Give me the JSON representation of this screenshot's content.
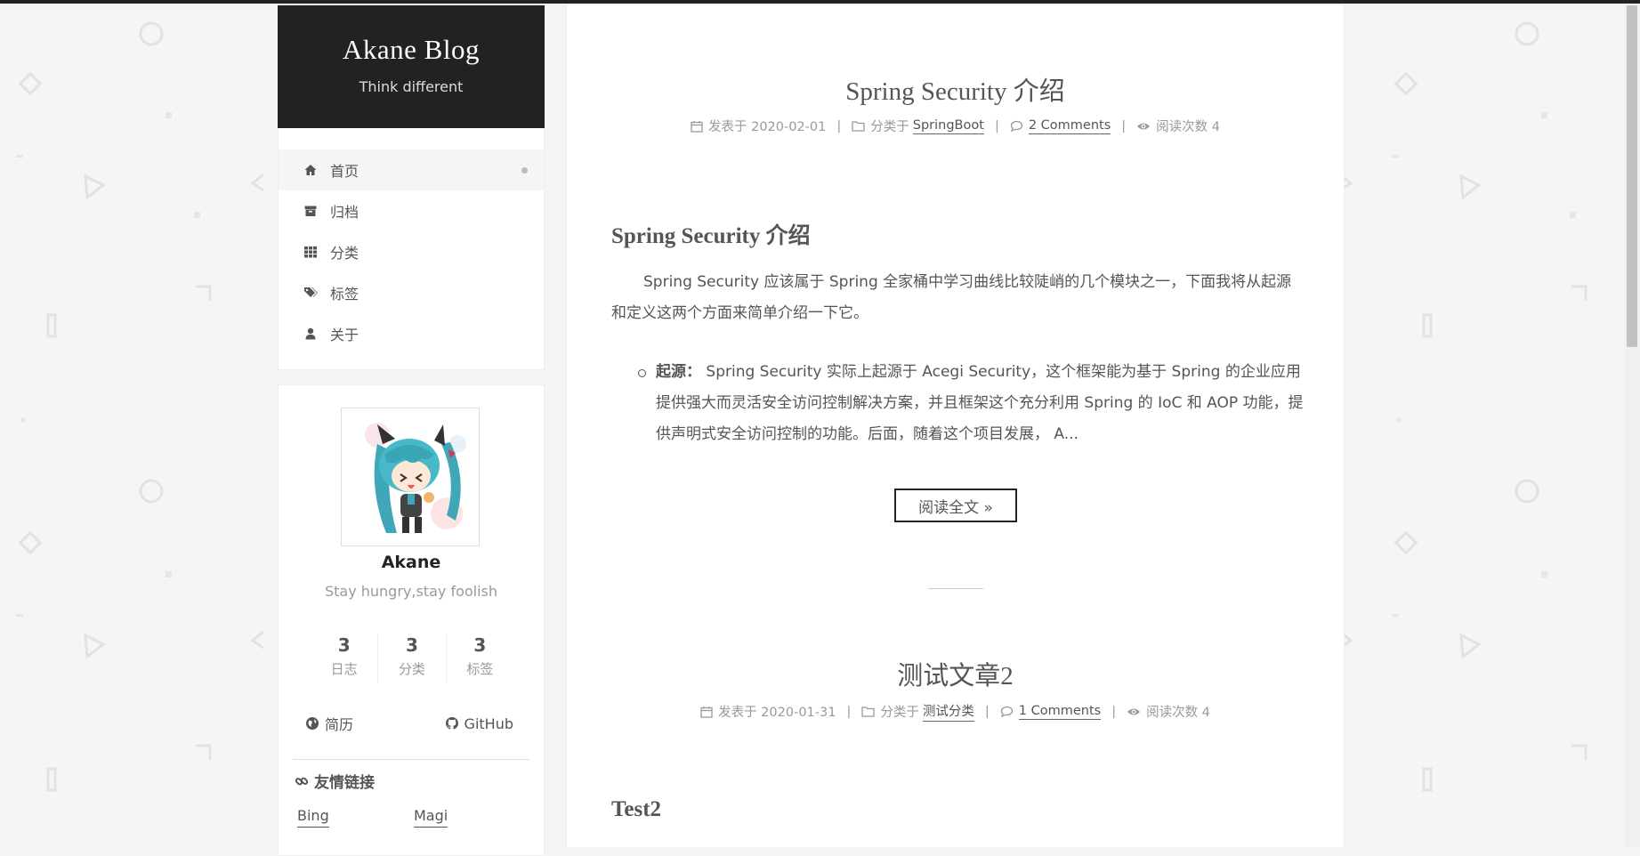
{
  "site": {
    "title": "Akane Blog",
    "subtitle": "Think different"
  },
  "menu": [
    {
      "label": "首页",
      "icon": "home-icon",
      "active": true
    },
    {
      "label": "归档",
      "icon": "archive-icon",
      "active": false
    },
    {
      "label": "分类",
      "icon": "th-icon",
      "active": false
    },
    {
      "label": "标签",
      "icon": "tags-icon",
      "active": false
    },
    {
      "label": "关于",
      "icon": "user-icon",
      "active": false
    }
  ],
  "profile": {
    "name": "Akane",
    "motto": "Stay hungry,stay foolish",
    "stats": [
      {
        "count": "3",
        "label": "日志"
      },
      {
        "count": "3",
        "label": "分类"
      },
      {
        "count": "3",
        "label": "标签"
      }
    ],
    "links": [
      {
        "label": "简历",
        "icon": "globe-icon"
      },
      {
        "label": "GitHub",
        "icon": "github-icon"
      }
    ],
    "friends_title": "友情链接",
    "friends": [
      "Bing",
      "Magi"
    ]
  },
  "posts": [
    {
      "title": "Spring Security 介绍",
      "meta": {
        "date_prefix": "发表于 2020-02-01",
        "category_prefix": "分类于",
        "category": "SpringBoot",
        "comments": "2 Comments",
        "views": "阅读次数 4"
      },
      "excerpt_heading": "Spring Security 介绍",
      "excerpt_para": "Spring Security 应该属于 Spring 全家桶中学习曲线比较陡峭的几个模块之一，下面我将从起源和定义这两个方面来简单介绍一下它。",
      "excerpt_li_label": "起源：",
      "excerpt_li_text": " Spring Security 实际上起源于 Acegi Security，这个框架能为基于 Spring 的企业应用提供强大而灵活安全访问控制解决方案，并且框架这个充分利用 Spring 的 IoC 和 AOP 功能，提供声明式安全访问控制的功能。后面，随着这个项目发展， A...",
      "read_more": "阅读全文 »"
    },
    {
      "title": "测试文章2",
      "meta": {
        "date_prefix": "发表于 2020-01-31",
        "category_prefix": "分类于",
        "category": "测试分类",
        "comments": "1 Comments",
        "views": "阅读次数 4"
      },
      "excerpt_heading": "Test2"
    }
  ],
  "separator": "|"
}
